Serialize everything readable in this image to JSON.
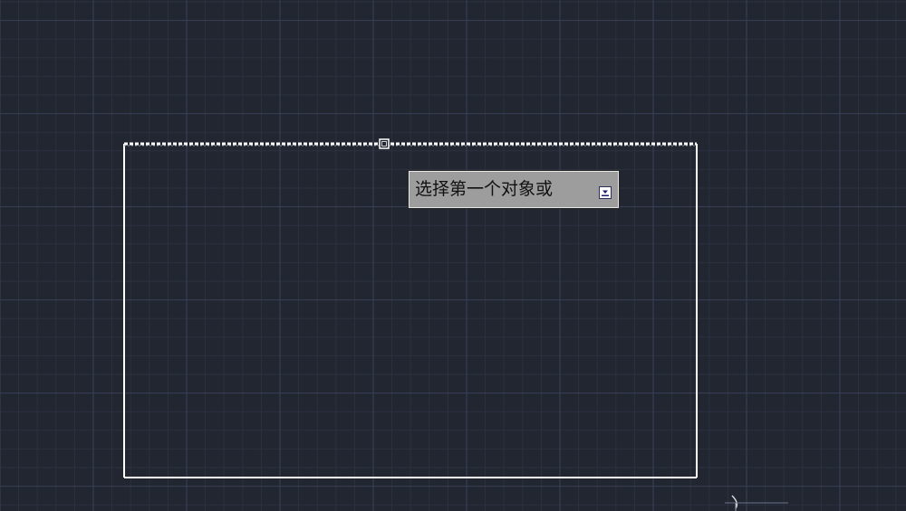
{
  "tooltip": {
    "prompt_text": "选择第一个对象或",
    "options_icon": "down-arrow-icon"
  },
  "colors": {
    "background": "#212630",
    "grid_minor": "#2b3140",
    "grid_major": "#394157",
    "rectangle": "#ffffff",
    "tooltip_bg": "#9d9d9d"
  }
}
